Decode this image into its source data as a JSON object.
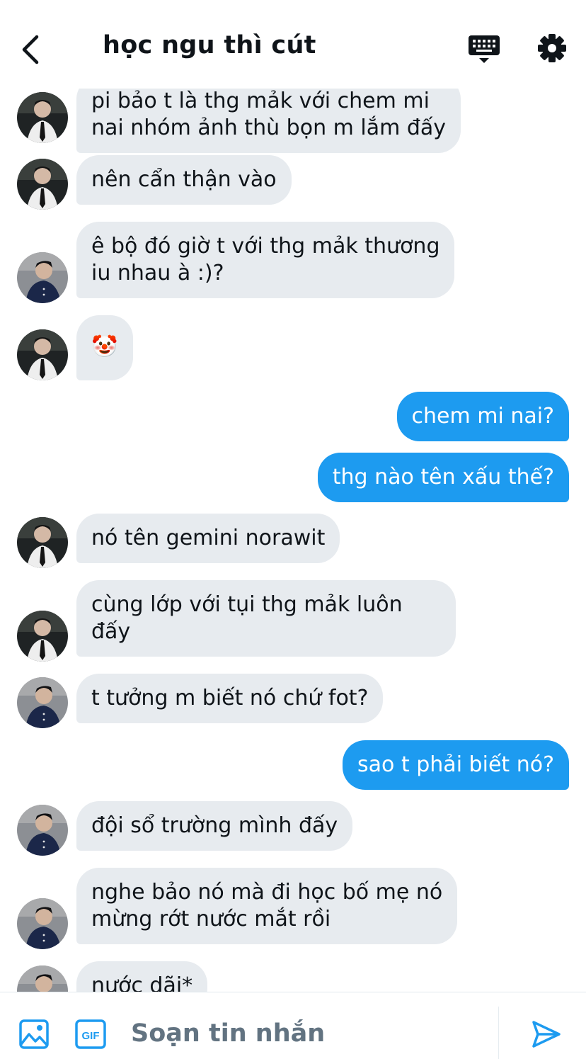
{
  "header": {
    "title": "học ngu thì cút",
    "back_icon": "chevron-left-icon",
    "keyboard_icon": "keyboard-icon",
    "settings_icon": "gear-icon"
  },
  "messages": [
    {
      "direction": "incoming",
      "sender": "a",
      "lines": [
        "pi bảo t là thg mảk với chem mi",
        "nai nhóm ảnh thù bọn m lắm đấy"
      ]
    },
    {
      "direction": "incoming",
      "sender": "a",
      "lines": [
        "nên cẩn thận vào"
      ]
    },
    {
      "direction": "incoming",
      "sender": "b",
      "lines": [
        "ê bộ đó giờ t với thg mảk thương",
        "iu nhau à :)?"
      ]
    },
    {
      "direction": "incoming",
      "sender": "a",
      "lines": [
        "🤡"
      ]
    },
    {
      "direction": "outgoing",
      "lines": [
        "chem mi nai?"
      ]
    },
    {
      "direction": "outgoing",
      "lines": [
        "thg nào tên xấu thế?"
      ]
    },
    {
      "direction": "incoming",
      "sender": "a",
      "lines": [
        "nó tên gemini norawit"
      ]
    },
    {
      "direction": "incoming",
      "sender": "a",
      "lines": [
        "cùng lớp với tụi thg mảk luôn",
        "đấy"
      ]
    },
    {
      "direction": "incoming",
      "sender": "b",
      "lines": [
        "t tưởng m biết nó chứ fot?"
      ]
    },
    {
      "direction": "outgoing",
      "lines": [
        "sao t phải biết nó?"
      ]
    },
    {
      "direction": "incoming",
      "sender": "b",
      "lines": [
        "đội sổ trường mình đấy"
      ]
    },
    {
      "direction": "incoming",
      "sender": "b",
      "lines": [
        "nghe bảo nó mà đi học bố mẹ nó",
        "mừng rớt nước mắt rồi"
      ]
    },
    {
      "direction": "incoming",
      "sender": "b",
      "lines": [
        "nước dãi*"
      ]
    }
  ],
  "composer": {
    "placeholder": "Soạn tin nhắn",
    "image_icon": "image-icon",
    "gif_icon": "gif-icon",
    "gif_label": "GIF",
    "send_icon": "send-icon"
  },
  "colors": {
    "accent": "#1d9bf0",
    "incoming_bubble": "#e7ebef",
    "placeholder_text": "#627381"
  }
}
